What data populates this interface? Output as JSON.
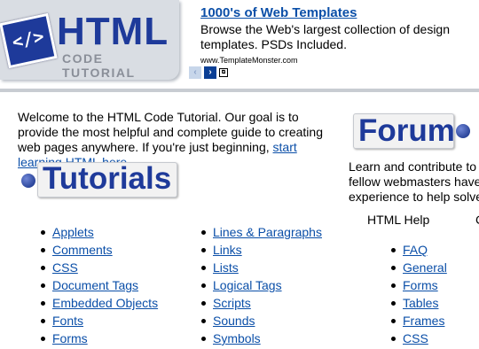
{
  "header": {
    "logo": {
      "badge": "</>",
      "title": "HTML",
      "subtitle": "CODE TUTORIAL"
    },
    "ad": {
      "title": "1000's of Web Templates",
      "description": "Browse the Web's largest collection of design templates. PSDs Included.",
      "url": "www.TemplateMonster.com",
      "prev": "‹",
      "next": "›",
      "popout": "⧉"
    }
  },
  "intro": {
    "text": "Welcome to the HTML Code Tutorial. Our goal is to provide the most helpful and complete guide to creating web pages anywhere. If you're just beginning, ",
    "link": "start learning HTML here",
    "end": "."
  },
  "tutorials": {
    "title": "Tutorials",
    "col1": [
      "Applets",
      "Comments",
      "CSS",
      "Document Tags",
      "Embedded Objects",
      "Fonts",
      "Forms"
    ],
    "col2": [
      "Lines & Paragraphs",
      "Links",
      "Lists",
      "Logical Tags",
      "Scripts",
      "Sounds",
      "Symbols"
    ]
  },
  "forum": {
    "title": "Forum",
    "lines": [
      "Learn and contribute to th",
      "fellow webmasters have t",
      "experience to help solve"
    ],
    "help_label": "HTML Help",
    "right_edge": "C",
    "help_links": [
      "FAQ",
      "General",
      "Forms",
      "Tables",
      "Frames",
      "CSS"
    ]
  },
  "colors": {
    "brand": "#1e3a9a",
    "link": "#0b4fa8",
    "logo_bg": "#d9dde3"
  }
}
